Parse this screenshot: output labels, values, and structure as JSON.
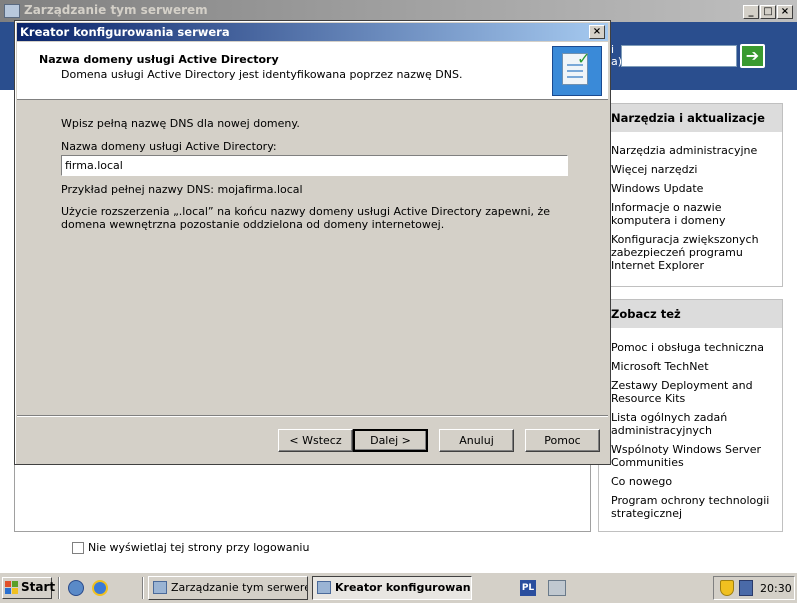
{
  "background_window": {
    "title": "Zarządzanie tym serwerem",
    "controls": [
      "_",
      "□",
      "×"
    ],
    "search_label_1": "i",
    "search_label_2": "a)",
    "search_value": "",
    "search_go_icon": "green-arrow-right"
  },
  "side_panels": [
    {
      "heading": "Narzędzia i aktualizacje",
      "links": [
        "Narzędzia administracyjne",
        "Więcej narzędzi",
        "Windows Update",
        "Informacje o nazwie komputera i domeny",
        "Konfiguracja zwiększonych zabezpieczeń programu Internet Explorer"
      ]
    },
    {
      "heading": "Zobacz też",
      "links": [
        "Pomoc i obsługa techniczna",
        "Microsoft TechNet",
        "Zestawy Deployment and Resource Kits",
        "Lista ogólnych zadań administracyjnych",
        "Wspólnoty Windows Server Communities",
        "Co nowego",
        "Program ochrony technologii strategicznej"
      ]
    }
  ],
  "hide_option": {
    "label": "Nie wyświetlaj tej strony przy logowaniu",
    "checked": false
  },
  "wizard": {
    "title": "Kreator konfigurowania serwera",
    "close": "×",
    "header_title": "Nazwa domeny usługi Active Directory",
    "header_subtitle": "Domena usługi Active Directory jest identyfikowana poprzez nazwę DNS.",
    "prompt": "Wpisz pełną nazwę DNS dla nowej domeny.",
    "field_label": "Nazwa domeny usługi Active Directory:",
    "field_value": "firma.local",
    "example": "Przykład pełnej nazwy DNS: mojafirma.local",
    "note": "Użycie rozszerzenia „.local” na końcu nazwy domeny usługi Active Directory zapewni, że domena wewnętrzna pozostanie oddzielona od domeny internetowej.",
    "buttons": {
      "back": "< Wstecz",
      "next": "Dalej >",
      "cancel": "Anuluj",
      "help": "Pomoc"
    }
  },
  "taskbar": {
    "start": "Start",
    "tasks": [
      {
        "label": "Zarządzanie tym serwerem",
        "active": false
      },
      {
        "label": "Kreator konfigurowan...",
        "active": true
      }
    ],
    "language": "PL",
    "clock": "20:30"
  }
}
